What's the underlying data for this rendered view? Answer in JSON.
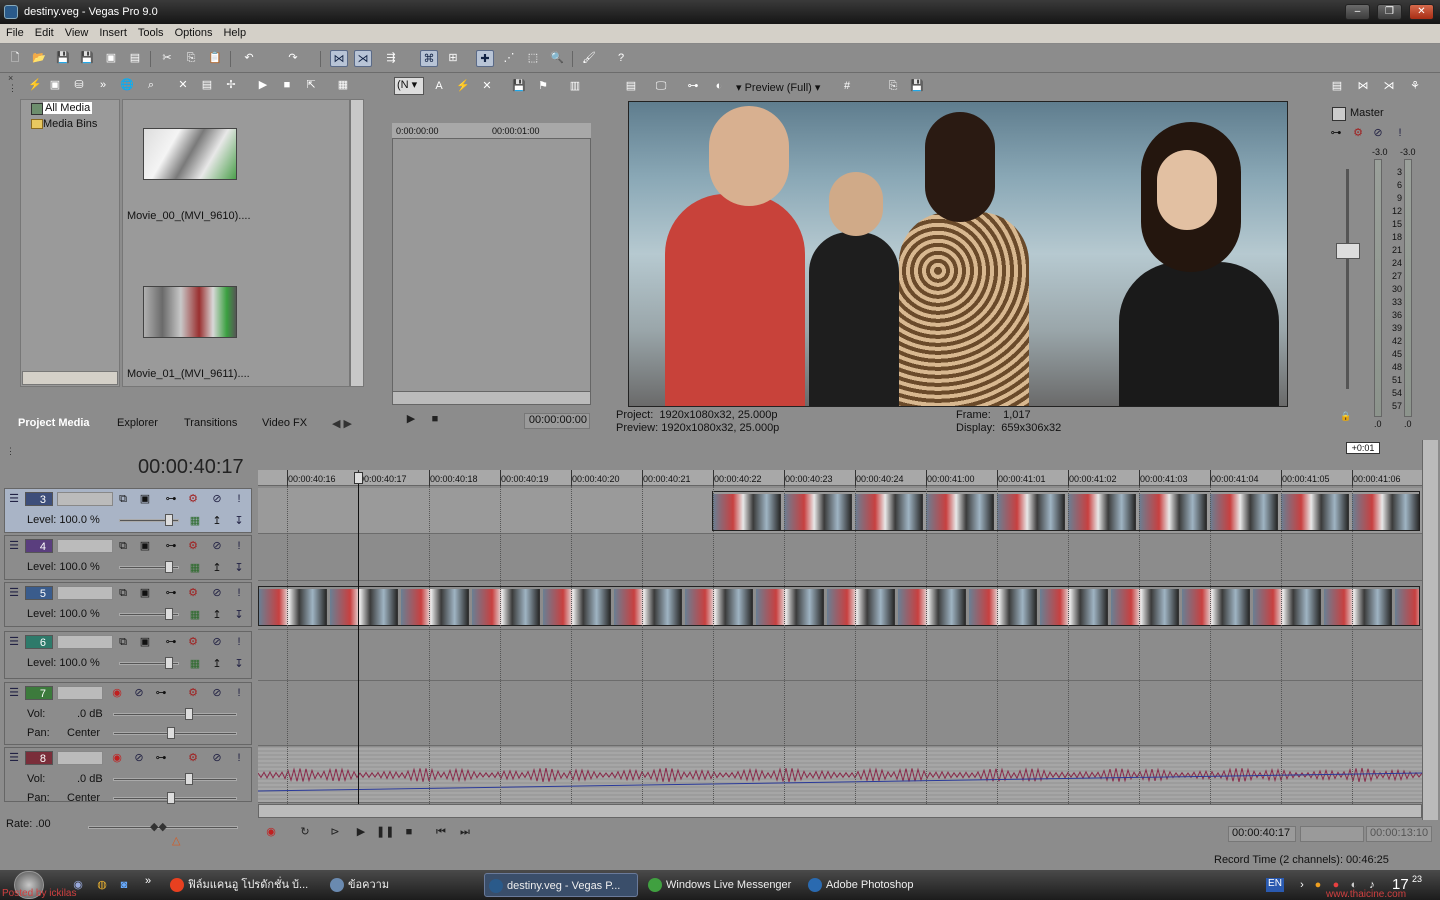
{
  "window": {
    "title": "destiny.veg - Vegas Pro 9.0"
  },
  "menu": [
    "File",
    "Edit",
    "View",
    "Insert",
    "Tools",
    "Options",
    "Help"
  ],
  "project_media": {
    "tree": [
      "All Media",
      "Media Bins"
    ],
    "items": [
      {
        "label": "Movie_00_(MVI_9610)...."
      },
      {
        "label": "Movie_01_(MVI_9611)...."
      }
    ],
    "tabs": [
      "Project Media",
      "Explorer",
      "Transitions",
      "Video FX"
    ]
  },
  "trimmer": {
    "ruler": [
      "0:00:00:00",
      "00:00:01:00"
    ],
    "time": "00:00:00:00"
  },
  "preview": {
    "mode": "Preview (Full)",
    "project_label": "Project:",
    "project_value": "1920x1080x32, 25.000p",
    "preview_label": "Preview:",
    "preview_value": "1920x1080x32, 25.000p",
    "frame_label": "Frame:",
    "frame_value": "1,017",
    "display_label": "Display:",
    "display_value": "659x306x32"
  },
  "master": {
    "label": "Master",
    "peak_left": "-3.0",
    "peak_right": "-3.0",
    "scale": [
      "3",
      "6",
      "9",
      "12",
      "15",
      "18",
      "21",
      "24",
      "27",
      "30",
      "33",
      "36",
      "39",
      "42",
      "45",
      "48",
      "51",
      "54",
      "57"
    ],
    "bottom_left": ".0",
    "bottom_right": ".0"
  },
  "timeline": {
    "clock": "00:00:40:17",
    "offset_badge": "+0:01",
    "ruler": [
      "00:00:40:16",
      "00:00:40:17",
      "00:00:40:18",
      "00:00:40:19",
      "00:00:40:20",
      "00:00:40:21",
      "00:00:40:22",
      "00:00:40:23",
      "00:00:40:24",
      "00:00:41:00",
      "00:00:41:01",
      "00:00:41:02",
      "00:00:41:03",
      "00:00:41:04",
      "00:00:41:05",
      "00:00:41:06"
    ],
    "video_tracks": [
      {
        "num": "3",
        "level": "Level: 100.0 %",
        "color": "#3d4e7a"
      },
      {
        "num": "4",
        "level": "Level: 100.0 %",
        "color": "#5a3e7e"
      },
      {
        "num": "5",
        "level": "Level: 100.0 %",
        "color": "#3a5c8c"
      },
      {
        "num": "6",
        "level": "Level: 100.0 %",
        "color": "#2e7a6a"
      }
    ],
    "audio_tracks": [
      {
        "num": "7",
        "vol_label": "Vol:",
        "vol_value": ".0 dB",
        "pan_label": "Pan:",
        "pan_value": "Center",
        "color": "#3c7a3c"
      },
      {
        "num": "8",
        "vol_label": "Vol:",
        "vol_value": ".0 dB",
        "pan_label": "Pan:",
        "pan_value": "Center",
        "color": "#7a2e3a"
      }
    ],
    "rate": "Rate: .00"
  },
  "transport": {
    "position": "00:00:40:17",
    "length": "00:00:13:10"
  },
  "status": {
    "record_time": "Record Time (2 channels): 00:46:25"
  },
  "taskbar": {
    "tasks": [
      "ฟิล์มแคนอู โปรดักชั่น บ้...",
      "ข้อความ",
      "destiny.veg - Vegas P...",
      "Windows Live Messenger",
      "Adobe Photoshop"
    ],
    "lang": "EN",
    "clock": "17",
    "clock_small": "23",
    "watermark_left": "Posted by ickilas",
    "watermark_right": "www.thaicine.com"
  }
}
